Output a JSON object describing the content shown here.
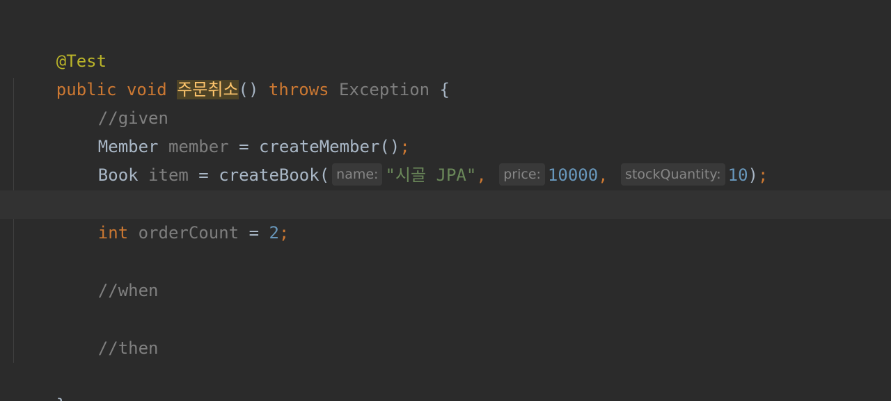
{
  "code": {
    "annotation": "@Test",
    "signature": {
      "modifier": "public",
      "return_type": "void",
      "method_name": "주문취소",
      "parens": "()",
      "throws_kw": "throws",
      "exception": "Exception",
      "open_brace": "{"
    },
    "comment_given": "//given",
    "member_line": {
      "type": "Member",
      "var": "member",
      "eq": "=",
      "call": "createMember()",
      "semi": ";"
    },
    "book_line": {
      "type": "Book",
      "var": "item",
      "eq": "=",
      "call_open": "createBook(",
      "hint_name": "name:",
      "arg_name": "\"시골 JPA\"",
      "comma1": ",",
      "hint_price": "price:",
      "arg_price": "10000",
      "comma2": ",",
      "hint_stock": "stockQuantity:",
      "arg_stock": "10",
      "close": ")",
      "semi": ";"
    },
    "order_line": {
      "type": "int",
      "var": "orderCount",
      "eq": "=",
      "value": "2",
      "semi": ";"
    },
    "comment_when": "//when",
    "comment_then": "//then",
    "close_brace": "}"
  },
  "colors": {
    "background": "#2b2b2b",
    "current_line": "#323232",
    "keyword": "#cc7832",
    "annotation": "#bbb529",
    "method_declaration": "#ffc66d",
    "string": "#6a8759",
    "number": "#6897bb",
    "comment": "#808080",
    "default_text": "#a9b7c6"
  }
}
